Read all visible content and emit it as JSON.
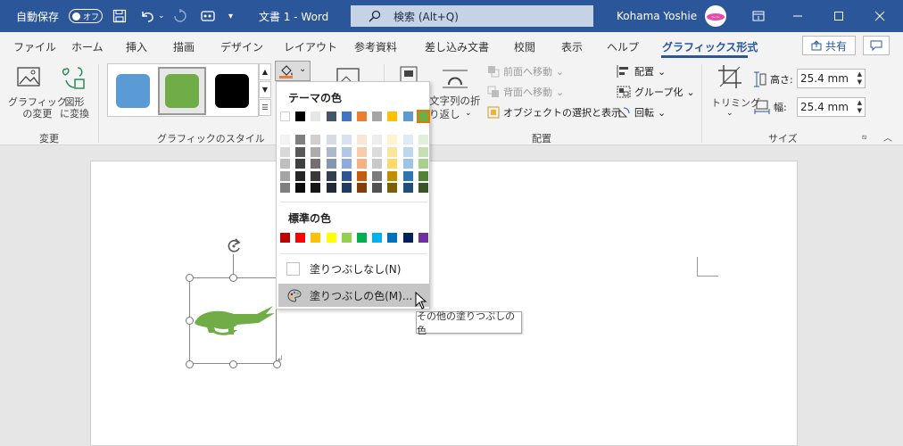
{
  "titlebar": {
    "autosave_label": "自動保存",
    "autosave_state": "オフ",
    "doc_title": "文書 1 - Word",
    "search_placeholder": "検索 (Alt+Q)",
    "user_name": "Kohama Yoshie",
    "bg_color": "#2b579a"
  },
  "tabs": [
    {
      "label": "ファイル"
    },
    {
      "label": "ホーム"
    },
    {
      "label": "挿入"
    },
    {
      "label": "描画"
    },
    {
      "label": "デザイン"
    },
    {
      "label": "レイアウト"
    },
    {
      "label": "参考資料"
    },
    {
      "label": "差し込み文書"
    },
    {
      "label": "校閲"
    },
    {
      "label": "表示"
    },
    {
      "label": "ヘルプ"
    },
    {
      "label": "グラフィックス形式",
      "active": true
    }
  ],
  "share_label": "共有",
  "ribbon": {
    "change_group": {
      "name": "変更",
      "change_graphic": "グラフィック\nの変更",
      "convert_shape": "図形\nに変換"
    },
    "style_group": {
      "name": "グラフィックのスタイル",
      "swatches": [
        "#5b9bd5",
        "#70ad47",
        "#000000"
      ]
    },
    "arrange_group": {
      "name": "配置",
      "wrap_text": "文字列の折\nり返し",
      "bring_forward": "前面へ移動",
      "send_backward": "背面へ移動",
      "selection_pane": "オブジェクトの選択と表示",
      "align": "配置",
      "group": "グループ化",
      "rotate": "回転"
    },
    "size_group": {
      "name": "サイズ",
      "crop": "トリミング",
      "height_label": "高さ:",
      "height_value": "25.4 mm",
      "width_label": "幅:",
      "width_value": "25.4 mm"
    }
  },
  "dropdown": {
    "theme_heading": "テーマの色",
    "theme_top": [
      "#ffffff",
      "#000000",
      "#e7e6e6",
      "#44546a",
      "#4472c4",
      "#ed7d31",
      "#a5a5a5",
      "#ffc000",
      "#5b9bd5",
      "#70ad47"
    ],
    "theme_shades": [
      [
        "#f2f2f2",
        "#7f7f7f",
        "#d0cece",
        "#d6dce4",
        "#d9e2f3",
        "#fbe5d5",
        "#ededed",
        "#fff2cc",
        "#deebf6",
        "#e2efd9"
      ],
      [
        "#d8d8d8",
        "#595959",
        "#aeabab",
        "#adb9ca",
        "#b4c6e7",
        "#f7cbac",
        "#dbdbdb",
        "#fee599",
        "#bdd7ee",
        "#c5e0b3"
      ],
      [
        "#bfbfbf",
        "#3f3f3f",
        "#757070",
        "#8496b0",
        "#8eaadb",
        "#f4b183",
        "#c9c9c9",
        "#ffd965",
        "#9dc3e6",
        "#a8d08d"
      ],
      [
        "#a5a5a5",
        "#262626",
        "#3a3838",
        "#323f4f",
        "#2f5496",
        "#c55a11",
        "#7b7b7b",
        "#bf8f00",
        "#2e75b5",
        "#538135"
      ],
      [
        "#7f7f7f",
        "#0c0c0c",
        "#171616",
        "#222a35",
        "#1f3864",
        "#833c0b",
        "#525252",
        "#7f6000",
        "#1e4e79",
        "#375623"
      ]
    ],
    "standard_heading": "標準の色",
    "standard": [
      "#c00000",
      "#ff0000",
      "#ffc000",
      "#ffff00",
      "#92d050",
      "#00b050",
      "#00b0f0",
      "#0070c0",
      "#002060",
      "#7030a0"
    ],
    "no_fill": "塗りつぶしなし(N)",
    "more_colors": "塗りつぶしの色(M)..."
  },
  "tooltip": "その他の塗りつぶしの色",
  "shape": {
    "name": "crocodile",
    "color": "#70ad47"
  }
}
